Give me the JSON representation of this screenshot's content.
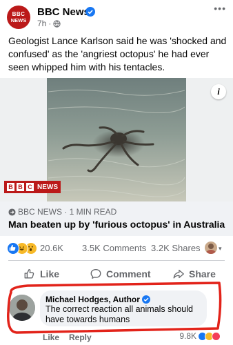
{
  "post": {
    "page_name": "BBC News",
    "page_avatar": {
      "line1": "BBC",
      "line2": "NEWS"
    },
    "time": "7h",
    "separator": "·",
    "more": "•••",
    "text": "Geologist Lance Karlson said he was 'shocked and confused' as the 'angriest octopus' he had ever seen whipped him with his tentacles."
  },
  "link_card": {
    "info": "i",
    "watermark_box": "B",
    "watermark_box2": "B",
    "watermark_box3": "C",
    "watermark_word": "NEWS",
    "domain": "BBC NEWS · 1 MIN READ",
    "title": "Man beaten up by 'furious octopus' in Australia"
  },
  "engagement": {
    "reactions_count": "20.6K",
    "comments": "3.5K Comments",
    "shares": "3.2K Shares",
    "caret": "▾"
  },
  "actions": {
    "like": "Like",
    "comment": "Comment",
    "share": "Share"
  },
  "comment": {
    "author": "Michael Hodges, Author",
    "text": "The correct reaction all animals should have towards humans",
    "like": "Like",
    "reply": "Reply",
    "reactions_count": "9.8K"
  },
  "colors": {
    "bbc_red": "#bb1919",
    "fb_blue": "#1877f2",
    "annotation_red": "#e2231a"
  }
}
